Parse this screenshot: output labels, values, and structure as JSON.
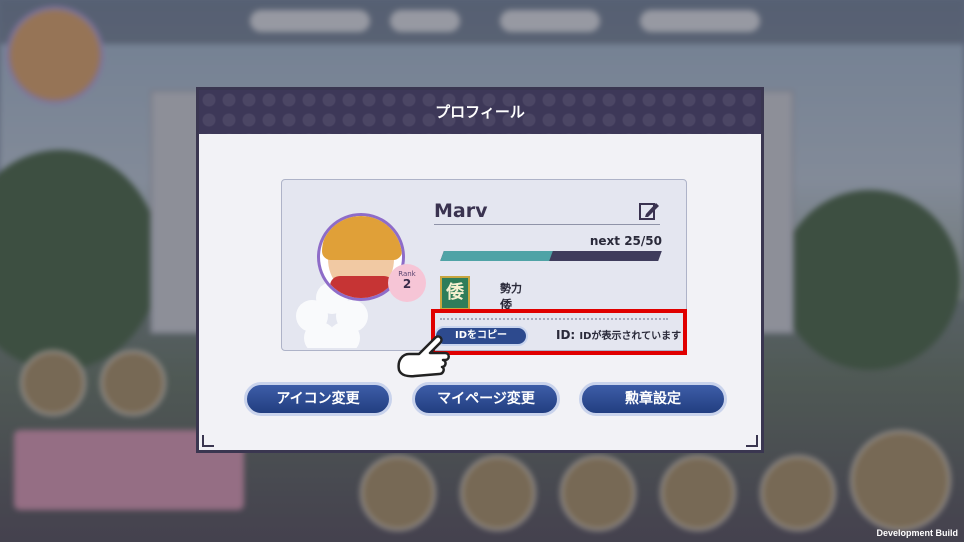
{
  "dialog": {
    "title": "プロフィール"
  },
  "profile": {
    "name": "Marv",
    "rank_label": "Rank",
    "rank_value": "2",
    "next_text": "next 25/50",
    "exp_current": 25,
    "exp_max": 50,
    "faction_emblem": "倭",
    "faction_label": "勢力",
    "faction_name": "倭",
    "copy_id_button": "IDをコピー",
    "id_label": "ID:",
    "id_value": "IDが表示されています"
  },
  "buttons": {
    "icon_change": "アイコン変更",
    "mypage_change": "マイページ変更",
    "badge_settings": "勲章設定"
  },
  "footer": {
    "dev_build": "Development Build"
  },
  "colors": {
    "highlight": "#e00000",
    "header": "#3d3858",
    "button": "#2d4a8e",
    "exp_fill": "#4fa3a6"
  },
  "icons": {
    "edit": "edit-pencil-icon",
    "pointer": "pointing-hand-icon"
  }
}
